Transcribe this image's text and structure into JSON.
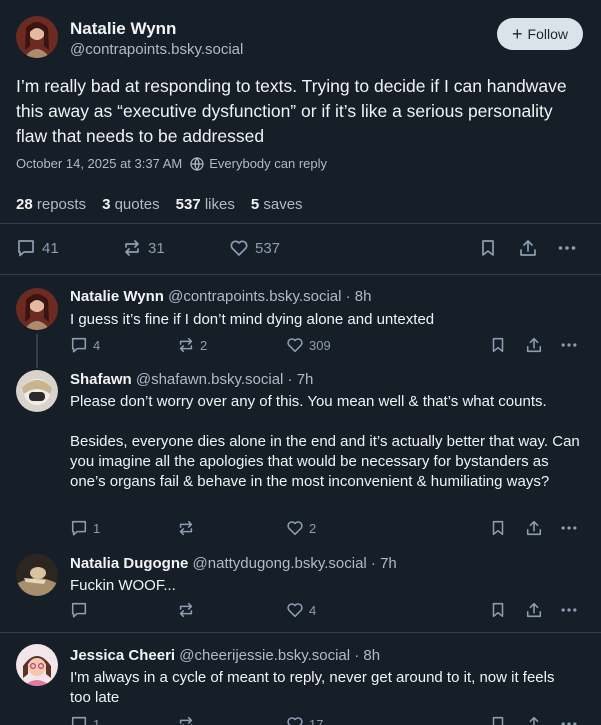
{
  "main_post": {
    "author_name": "Natalie Wynn",
    "handle": "@contrapoints.bsky.social",
    "follow_label": "Follow",
    "text": "I’m really bad at responding to texts. Trying to decide if I can handwave this away as “executive dysfunction” or if it’s like a serious personality flaw that needs to be addressed",
    "timestamp": "October 14, 2025 at 3:37 AM",
    "reply_setting": "Everybody can reply",
    "stats": {
      "reposts_count": "28",
      "reposts_label": "reposts",
      "quotes_count": "3",
      "quotes_label": "quotes",
      "likes_count": "537",
      "likes_label": "likes",
      "saves_count": "5",
      "saves_label": "saves"
    },
    "actions": {
      "replies": "41",
      "reposts": "31",
      "likes": "537"
    }
  },
  "replies": [
    {
      "name": "Natalie Wynn",
      "handle": "@contrapoints.bsky.social · 8h",
      "paragraphs": [
        "I guess it’s fine if I don’t mind dying alone and untexted"
      ],
      "replies": "4",
      "reposts": "2",
      "likes": "309"
    },
    {
      "name": "Shafawn",
      "handle": "@shafawn.bsky.social · 7h",
      "paragraphs": [
        "Please don’t worry over any of this. You mean well & that’s what counts.",
        "Besides, everyone dies alone in the end and it’s actually better that way. Can you imagine all the apologies that would be necessary for bystanders as one’s organs fail & behave in the most inconvenient & humiliating ways?"
      ],
      "replies": "1",
      "reposts": "",
      "likes": "2"
    },
    {
      "name": "Natalia Dugogne",
      "handle": "@nattydugong.bsky.social · 7h",
      "paragraphs": [
        "Fuckin WOOF..."
      ],
      "replies": "",
      "reposts": "",
      "likes": "4"
    },
    {
      "name": "Jessica Cheeri",
      "handle": "@cheerijessie.bsky.social · 8h",
      "paragraphs": [
        "I'm always in a cycle of meant to reply, never get around to it, now it feels too late"
      ],
      "replies": "1",
      "reposts": "",
      "likes": "17"
    }
  ],
  "colors": {
    "background": "#161e27",
    "text": "#f1f3f5",
    "muted": "#aebbc9",
    "icon": "#8c9eb2",
    "border": "#2e4052",
    "follow_bg": "#dce2ea"
  }
}
